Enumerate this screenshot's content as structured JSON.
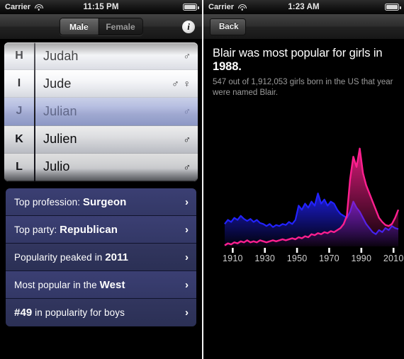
{
  "left": {
    "statusbar": {
      "carrier": "Carrier",
      "time": "11:15 PM",
      "wifi_icon": "wifi-icon",
      "battery_icon": "battery-icon"
    },
    "navbar": {
      "segments": [
        {
          "label": "Male",
          "selected": true
        },
        {
          "label": "Female",
          "selected": false
        }
      ],
      "info_icon": "info-icon",
      "info_label": "i"
    },
    "picker": {
      "rows": [
        {
          "letter": "H",
          "name": "Judah",
          "symbols": "♂",
          "selected": false
        },
        {
          "letter": "I",
          "name": "Jude",
          "symbols": "♂ ♀",
          "selected": false
        },
        {
          "letter": "J",
          "name": "Julian",
          "symbols": "♂",
          "selected": true
        },
        {
          "letter": "K",
          "name": "Julien",
          "symbols": "♂",
          "selected": false
        },
        {
          "letter": "L",
          "name": "Julio",
          "symbols": "♂",
          "selected": false
        }
      ]
    },
    "facts": [
      {
        "prefix": "Top profession: ",
        "value": "Surgeon",
        "suffix": "",
        "chevron": "›"
      },
      {
        "prefix": "Top party: ",
        "value": "Republican",
        "suffix": "",
        "chevron": "›"
      },
      {
        "prefix": "Popularity peaked in ",
        "value": "2011",
        "suffix": "",
        "chevron": "›"
      },
      {
        "prefix": "Most popular in the ",
        "value": "West",
        "suffix": "",
        "chevron": "›"
      },
      {
        "prefix": "",
        "value": "#49",
        "suffix": " in popularity for boys",
        "chevron": "›"
      }
    ]
  },
  "right": {
    "statusbar": {
      "carrier": "Carrier",
      "time": "1:23 AM",
      "wifi_icon": "wifi-icon",
      "battery_icon": "battery-icon"
    },
    "navbar": {
      "back_label": "Back"
    },
    "headline_lead": "Blair was most popular for girls in ",
    "headline_year": "1988.",
    "subtitle": "547 out of 1,912,053 girls born in the US that year were named Blair."
  },
  "colors": {
    "girls_line": "#ff1f8f",
    "boys_line": "#2222ff",
    "background": "#000000",
    "fact_row_a": "#3b3f73",
    "fact_row_b": "#32365f",
    "selected_row": "#aeb7de"
  },
  "chart_data": {
    "type": "line",
    "title": "",
    "xlabel": "",
    "ylabel": "",
    "xlim": [
      1905,
      2013
    ],
    "ylim": [
      0,
      100
    ],
    "grid": false,
    "legend": "none",
    "ticks": [
      1910,
      1930,
      1950,
      1970,
      1990,
      2010
    ],
    "x": [
      1905,
      1907,
      1909,
      1911,
      1913,
      1915,
      1917,
      1919,
      1921,
      1923,
      1925,
      1927,
      1929,
      1931,
      1933,
      1935,
      1937,
      1939,
      1941,
      1943,
      1945,
      1947,
      1949,
      1951,
      1953,
      1955,
      1957,
      1959,
      1961,
      1963,
      1965,
      1967,
      1969,
      1971,
      1973,
      1975,
      1977,
      1979,
      1981,
      1983,
      1985,
      1987,
      1989,
      1991,
      1993,
      1995,
      1997,
      1999,
      2001,
      2003,
      2005,
      2007,
      2009,
      2011,
      2013
    ],
    "series": [
      {
        "name": "girls",
        "color": "#ff1f8f",
        "values": [
          1,
          3,
          2,
          4,
          3,
          5,
          4,
          6,
          4,
          5,
          4,
          6,
          5,
          4,
          5,
          6,
          5,
          6,
          7,
          6,
          7,
          8,
          7,
          9,
          8,
          10,
          9,
          12,
          11,
          13,
          12,
          14,
          13,
          15,
          14,
          16,
          18,
          22,
          30,
          66,
          88,
          78,
          96,
          72,
          60,
          52,
          44,
          36,
          28,
          24,
          21,
          20,
          22,
          28,
          36
        ]
      },
      {
        "name": "boys",
        "color": "#2222ff",
        "values": [
          22,
          26,
          24,
          28,
          26,
          30,
          27,
          25,
          27,
          24,
          26,
          23,
          22,
          20,
          22,
          19,
          21,
          20,
          22,
          21,
          24,
          22,
          26,
          40,
          36,
          42,
          38,
          44,
          40,
          52,
          42,
          46,
          40,
          44,
          42,
          36,
          32,
          30,
          28,
          34,
          44,
          38,
          34,
          28,
          22,
          18,
          14,
          12,
          16,
          14,
          18,
          16,
          20,
          18,
          17
        ]
      }
    ]
  }
}
